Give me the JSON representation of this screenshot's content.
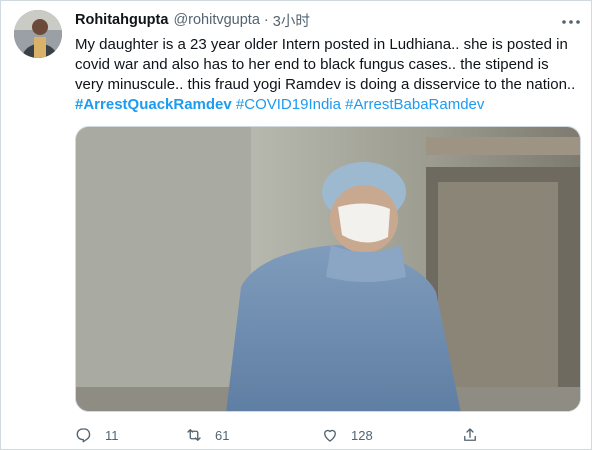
{
  "tweet": {
    "display_name": "Rohitahgupta",
    "handle": "@rohitvgupta",
    "separator": "·",
    "time": "3小时",
    "text": "My daughter is a 23 year older Intern posted in Ludhiana.. she is posted in covid war and also has to her end to black fungus cases.. the stipend is very minuscule.. this fraud yogi Ramdev is doing a disservice to the nation..",
    "hashtags": [
      "#ArrestQuackRamdev",
      "#COVID19India",
      "#ArrestBabaRamdev"
    ],
    "more_icon": "more-horizontal-icon",
    "media": {
      "description_icon": "photo"
    },
    "actions": [
      {
        "icon": "reply-icon",
        "count": "11"
      },
      {
        "icon": "retweet-icon",
        "count": "61"
      },
      {
        "icon": "like-icon",
        "count": "128"
      },
      {
        "icon": "share-icon",
        "count": ""
      }
    ],
    "colors": {
      "link": "#1d9bf0",
      "secondary_text": "#536471",
      "border": "#cfd9de"
    }
  }
}
